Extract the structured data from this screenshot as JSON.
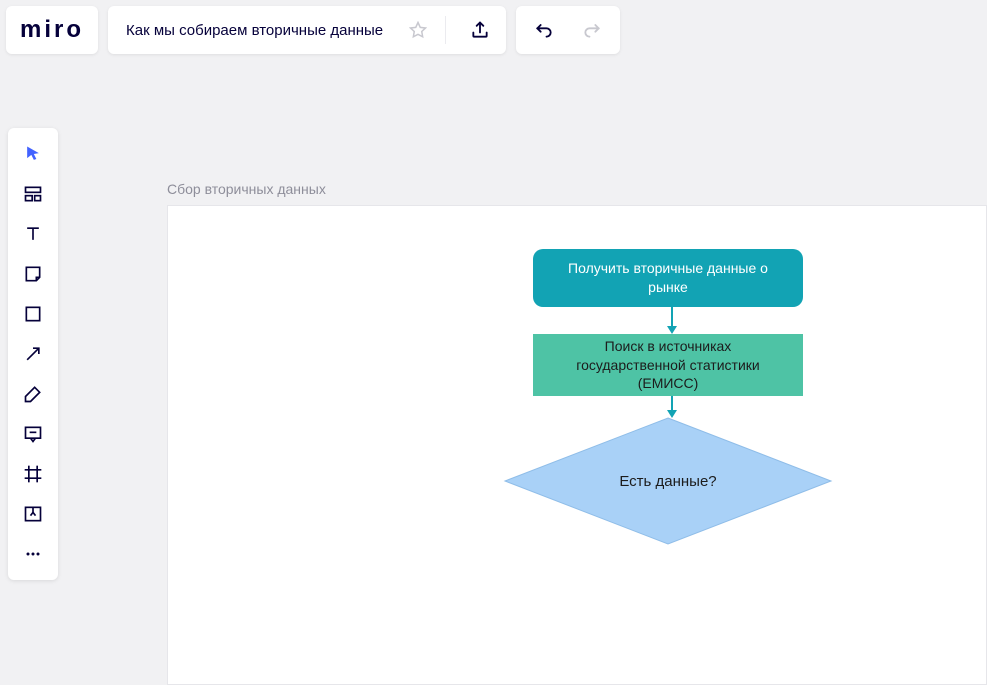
{
  "header": {
    "logo": "miro",
    "board_title": "Как мы собираем вторичные данные"
  },
  "frame": {
    "title": "Сбор вторичных данных"
  },
  "nodes": {
    "start": "Получить вторичные данные о рынке",
    "process": "Поиск в источниках государственной статистики (ЕМИСС)",
    "decision": "Есть данные?"
  },
  "colors": {
    "accent": "#4262ff",
    "node_start": "#12a3b4",
    "node_process": "#4ec3a5",
    "node_decision": "#a9d1f7"
  }
}
